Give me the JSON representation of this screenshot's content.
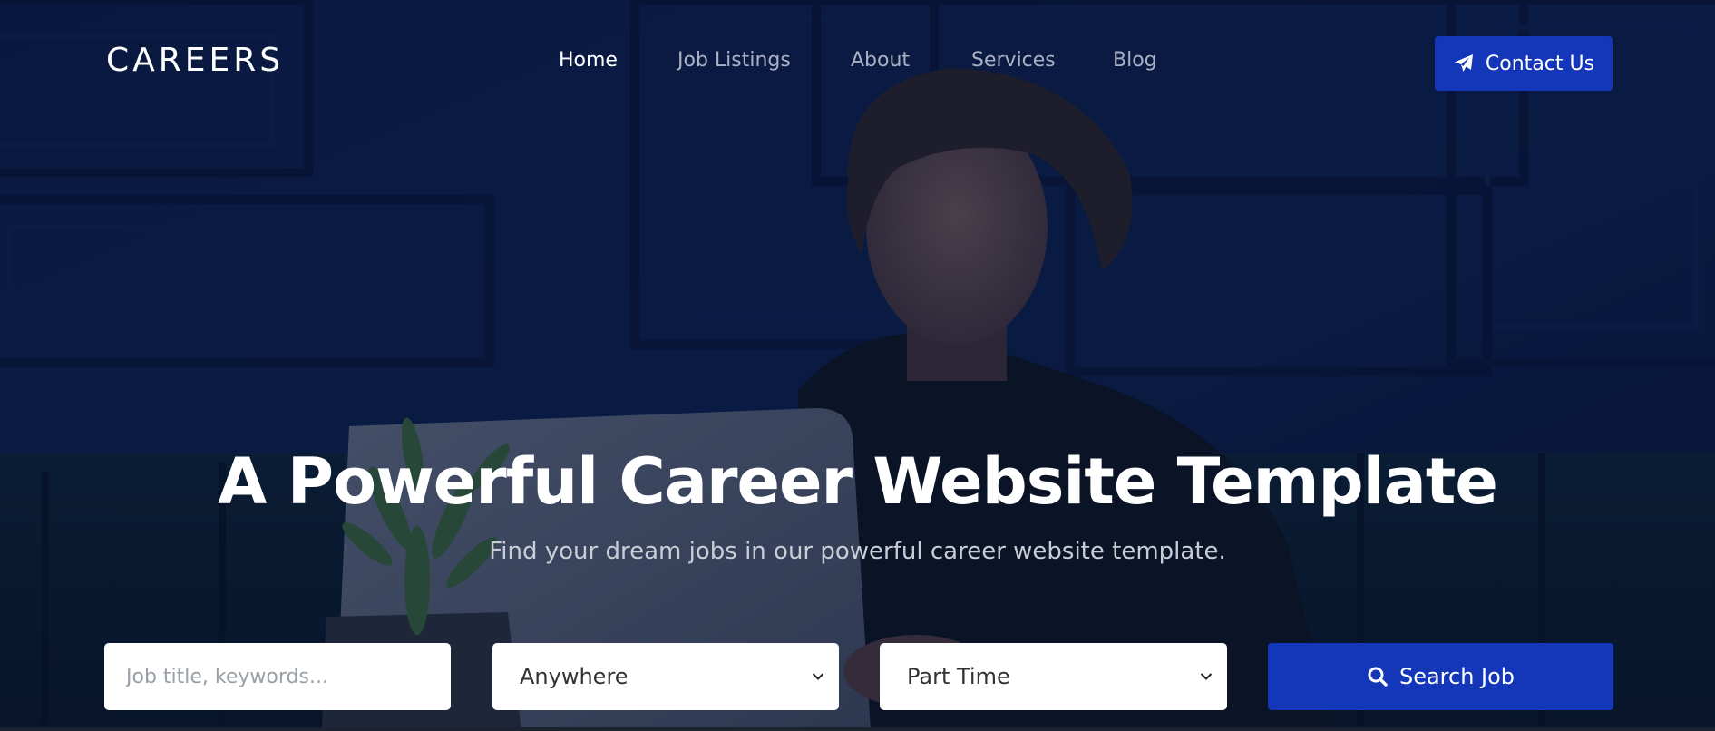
{
  "colors": {
    "accent": "#1436b8",
    "nav_inactive": "#a9b1c2",
    "overlay": "#0b1a3a"
  },
  "brand": {
    "logo": "CAREERS"
  },
  "nav": {
    "items": [
      {
        "label": "Home",
        "active": true
      },
      {
        "label": "Job Listings",
        "active": false
      },
      {
        "label": "About",
        "active": false
      },
      {
        "label": "Services",
        "active": false
      },
      {
        "label": "Blog",
        "active": false
      }
    ]
  },
  "header": {
    "contact_label": "Contact Us",
    "contact_icon": "paper-plane-icon"
  },
  "hero": {
    "title": "A Powerful Career Website Template",
    "subtitle": "Find your dream jobs in our powerful career website template."
  },
  "search": {
    "keywords_placeholder": "Job title, keywords...",
    "location_value": "Anywhere",
    "job_type_value": "Part Time",
    "button_label": "Search Job",
    "button_icon": "search-icon"
  }
}
